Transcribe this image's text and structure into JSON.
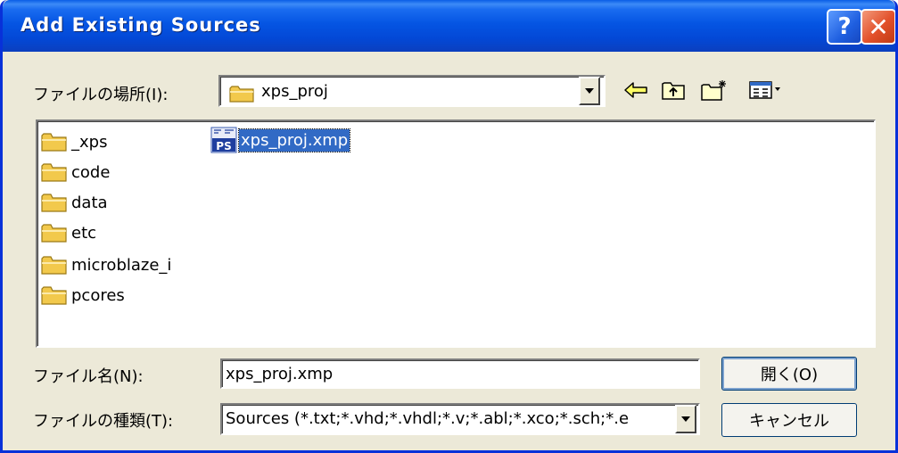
{
  "window": {
    "title": "Add Existing Sources",
    "help_label": "?",
    "close_label": "✕"
  },
  "look_in": {
    "label": "ファイルの場所(I):",
    "value": "xps_proj"
  },
  "toolbar": {
    "back_icon": "back-arrow-icon",
    "up_icon": "up-folder-icon",
    "new_folder_icon": "new-folder-icon",
    "view_icon": "view-menu-icon"
  },
  "files": {
    "folders": [
      "_xps",
      "code",
      "data",
      "etc",
      "microblaze_i",
      "pcores"
    ],
    "selected_file": {
      "name": "xps_proj.xmp",
      "icon": "xps-project-icon",
      "icon_badge": "PS"
    }
  },
  "filename": {
    "label": "ファイル名(N):",
    "value": "xps_proj.xmp"
  },
  "filetype": {
    "label": "ファイルの種類(T):",
    "value": "Sources (*.txt;*.vhd;*.vhdl;*.v;*.abl;*.xco;*.sch;*.e"
  },
  "buttons": {
    "open": "開く(O)",
    "cancel": "キャンセル"
  },
  "colors": {
    "title_bar": "#0555e3",
    "selection": "#316ac5",
    "dialog_bg": "#ece9d8",
    "close_button": "#e2502a",
    "folder": "#f2c94c"
  }
}
